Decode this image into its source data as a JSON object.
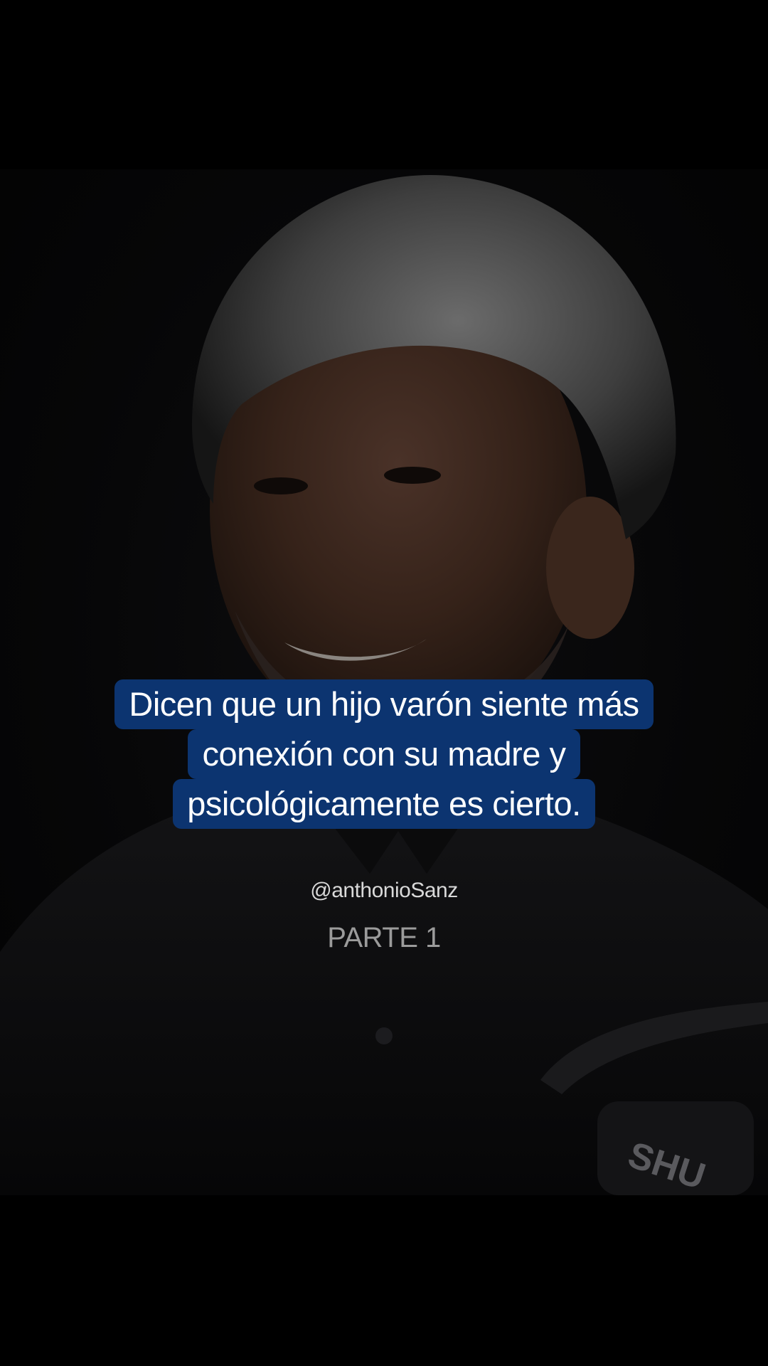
{
  "caption": {
    "lines": [
      "Dicen que un hijo varón siente más",
      "conexión con su madre y",
      "psicológicamente es cierto."
    ],
    "background_color": "#0c3470",
    "text_color": "#ffffff"
  },
  "handle": "@anthonioSanz",
  "part_label": "PARTE 1",
  "microphone_brand": "SHU"
}
